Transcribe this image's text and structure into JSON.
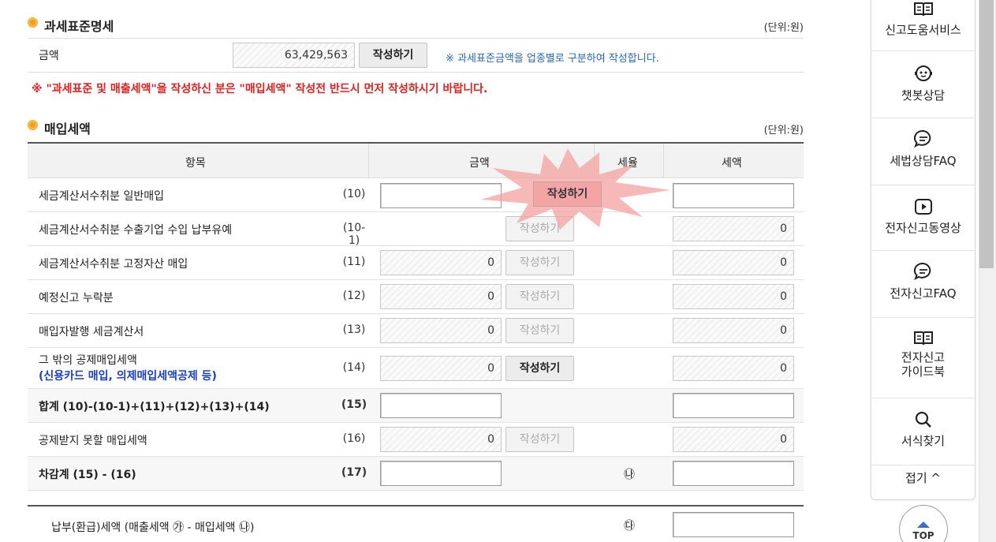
{
  "tax_base": {
    "title": "과세표준명세",
    "unit": "(단위:원)",
    "amount_label": "금액",
    "amount_value": "63,429,563",
    "write_button": "작성하기",
    "note": "※ 과세표준금액을 업종별로 구분하여 작성합니다."
  },
  "warning": "※ \"과세표준 및 매출세액\"을 작성하신 분은 \"매입세액\" 작성전 반드시 먼저 작성하시기 바랍니다.",
  "purchase_tax": {
    "title": "매입세액",
    "unit": "(단위:원)",
    "headers": {
      "item": "항목",
      "amount": "금액",
      "rate": "세율",
      "tax": "세액"
    },
    "rows": [
      {
        "label": "세금계산서수취분 일반매입",
        "num": "(10)",
        "amount": "",
        "button": "작성하기",
        "tax": ""
      },
      {
        "label": "세금계산서수취분 수출기업 수입 납부유예",
        "num": "(10-1)",
        "button": "작성하기",
        "tax": "0"
      },
      {
        "label": "세금계산서수취분 고정자산 매입",
        "num": "(11)",
        "amount": "0",
        "button": "작성하기",
        "tax": "0"
      },
      {
        "label": "예정신고 누락분",
        "num": "(12)",
        "amount": "0",
        "button": "작성하기",
        "tax": "0"
      },
      {
        "label": "매입자발행 세금계산서",
        "num": "(13)",
        "amount": "0",
        "button": "작성하기",
        "tax": "0"
      },
      {
        "label": "그 밖의 공제매입세액",
        "sublabel": "(신용카드 매입, 의제매입세액공제 등)",
        "num": "(14)",
        "amount": "0",
        "button": "작성하기",
        "tax": "0"
      },
      {
        "label": "합계 (10)-(10-1)+(11)+(12)+(13)+(14)",
        "num": "(15)",
        "amount": "",
        "tax": ""
      },
      {
        "label": "공제받지 못할 매입세액",
        "num": "(16)",
        "amount": "0",
        "button": "작성하기",
        "tax": "0"
      },
      {
        "label": "차감계 (15) - (16)",
        "num": "(17)",
        "amount": "",
        "rate_mark": "㉯",
        "tax": ""
      }
    ],
    "payable_label": "납부(환급)세액 (매출세액 ㉮ - 매입세액 ㉯)",
    "payable_mark": "㉰"
  },
  "sidebar": {
    "items": [
      {
        "label": "신고도움서비스",
        "icon": "book-icon"
      },
      {
        "label": "챗봇상담",
        "icon": "chatbot-icon"
      },
      {
        "label": "세법상담FAQ",
        "icon": "chat-bubble-icon"
      },
      {
        "label": "전자신고동영상",
        "icon": "play-icon"
      },
      {
        "label": "전자신고FAQ",
        "icon": "chat-bubble-icon"
      },
      {
        "label1": "전자신고",
        "label2": "가이드북",
        "icon": "book-icon"
      },
      {
        "label": "서식찾기",
        "icon": "search-icon"
      }
    ],
    "fold": "접기 ^"
  },
  "top_button": "TOP",
  "colors": {
    "warning": "#e02020",
    "note": "#2766b8",
    "highlight": "#f08080",
    "bullet": "#f0a020"
  }
}
